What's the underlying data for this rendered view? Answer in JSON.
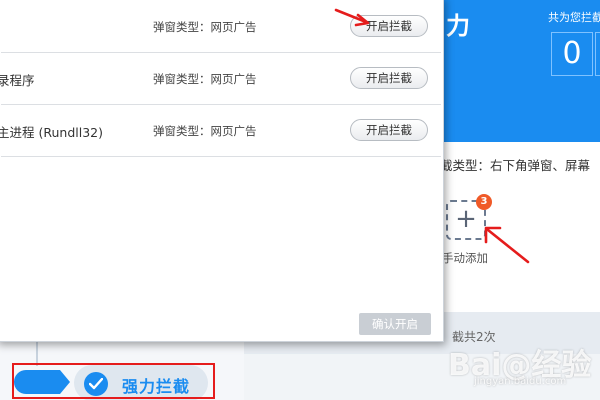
{
  "dialog": {
    "rows": [
      {
        "name": "",
        "type": "弹窗类型：网页广告",
        "button": "开启拦截"
      },
      {
        "name": "录程序",
        "type": "弹窗类型：网页广告",
        "button": "开启拦截"
      },
      {
        "name": "主进程 (Rundll32)",
        "type": "弹窗类型：网页广告",
        "button": "开启拦截"
      }
    ],
    "confirm_label": "确认开启"
  },
  "background": {
    "title_fragment": "力",
    "total_label": "共为您拦截",
    "counter_digits": [
      "0",
      "0"
    ],
    "types_text": "截类型：右下角弹窗、屏幕",
    "manual_add": {
      "badge": "3",
      "label": "手动添加",
      "icon": "plus-icon"
    },
    "count_text": "截共2次"
  },
  "bottom_tab": {
    "label": "强力拦截",
    "icon": "check-circle-icon"
  },
  "watermark": {
    "main": "Bai@经验",
    "sub": "jingyan.baidu.com"
  },
  "colors": {
    "accent": "#1a8cf0",
    "annotation": "#e51c1c",
    "badge": "#f05a28"
  }
}
